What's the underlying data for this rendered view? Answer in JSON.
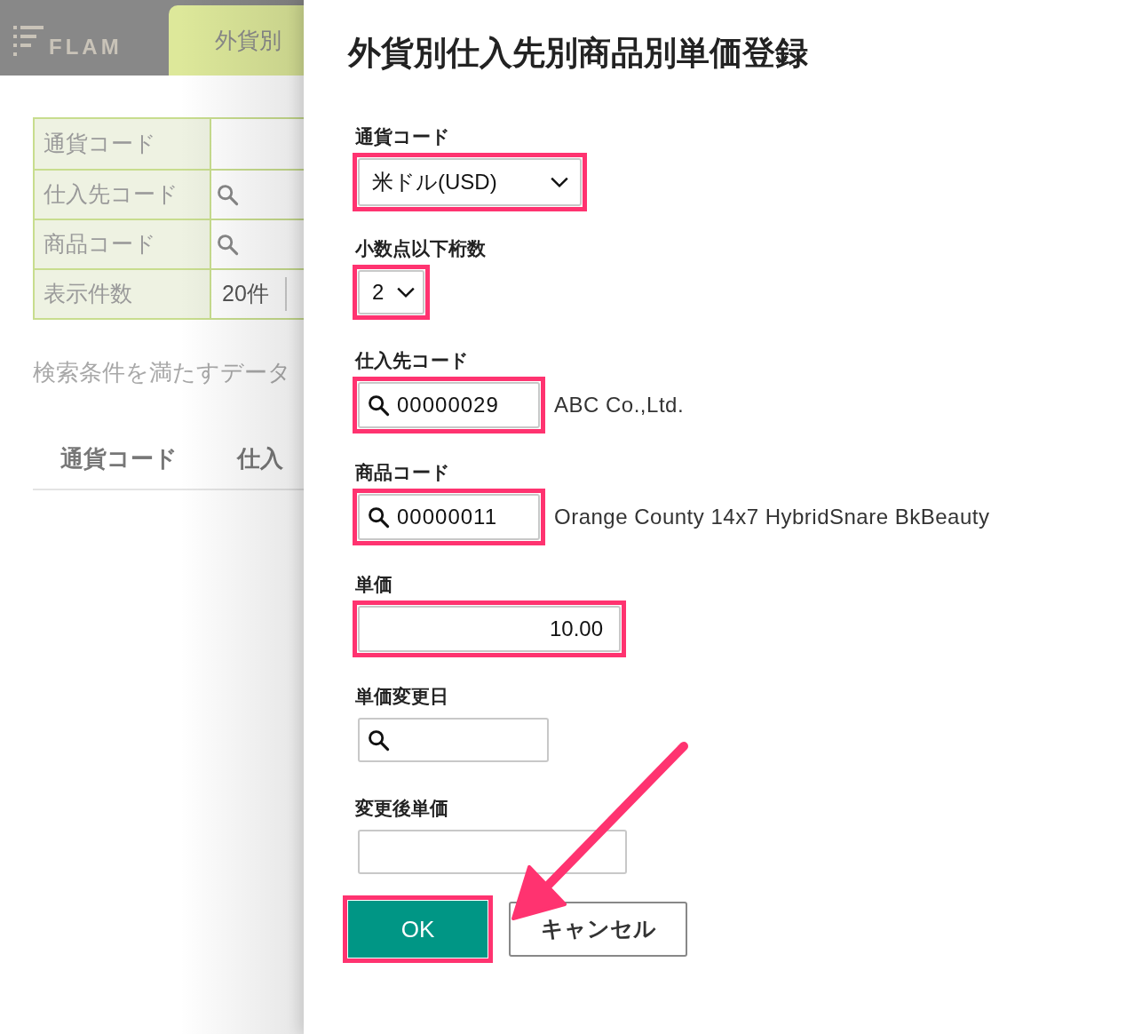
{
  "header": {
    "logo": "FLAM",
    "tab": "外貨別"
  },
  "search": {
    "rows": [
      {
        "label": "通貨コード",
        "kind": "blank"
      },
      {
        "label": "仕入先コード",
        "kind": "search"
      },
      {
        "label": "商品コード",
        "kind": "search"
      },
      {
        "label": "表示件数",
        "kind": "select",
        "value": "20件"
      }
    ]
  },
  "result_message": "検索条件を満たすデータ",
  "columns": [
    "通貨コード",
    "仕入"
  ],
  "dialog": {
    "title": "外貨別仕入先別商品別単価登録",
    "fields": [
      {
        "label": "通貨コード",
        "kind": "select",
        "value": "米ドル(USD)",
        "highlighted": true
      },
      {
        "label": "小数点以下桁数",
        "kind": "small-select",
        "value": "2",
        "highlighted": true
      },
      {
        "label": "仕入先コード",
        "kind": "lookup",
        "value": "00000029",
        "name": "ABC Co.,Ltd.",
        "highlighted": true
      },
      {
        "label": "商品コード",
        "kind": "lookup",
        "value": "00000011",
        "name": "Orange County 14x7 HybridSnare BkBeauty",
        "highlighted": true
      },
      {
        "label": "単価",
        "kind": "number",
        "value": "10.00",
        "highlighted": true
      },
      {
        "label": "単価変更日",
        "kind": "date",
        "highlighted": false
      },
      {
        "label": "変更後単価",
        "kind": "text",
        "highlighted": false
      }
    ],
    "buttons": [
      {
        "label": "OK",
        "kind": "primary",
        "highlighted": true
      },
      {
        "label": "キャンセル",
        "kind": "secondary",
        "highlighted": false
      }
    ]
  }
}
